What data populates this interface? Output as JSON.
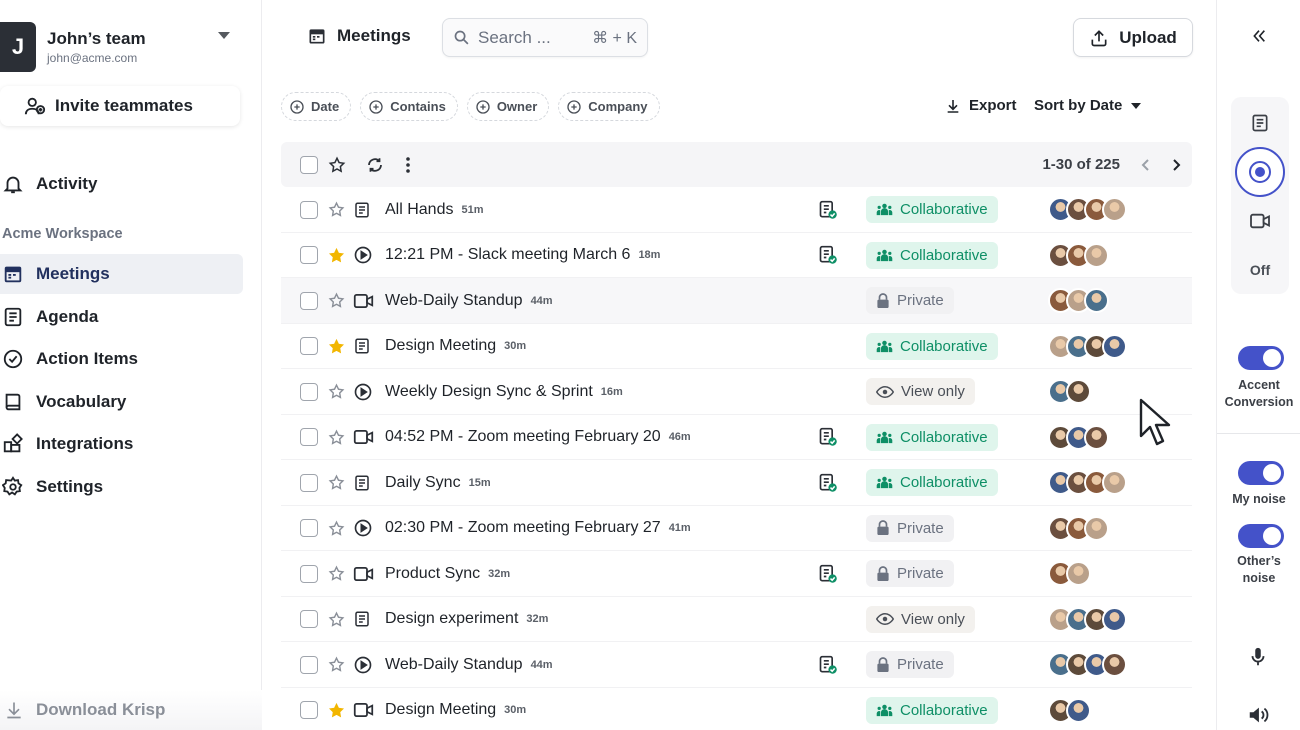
{
  "sidebar": {
    "team": {
      "initial": "J",
      "name": "John’s team",
      "email": "john@acme.com"
    },
    "invite_label": "Invite teammates",
    "activity_label": "Activity",
    "workspace_label": "Acme Workspace",
    "nav": [
      {
        "label": "Meetings",
        "icon": "calendar-icon",
        "active": true
      },
      {
        "label": "Agenda",
        "icon": "document-icon"
      },
      {
        "label": "Action Items",
        "icon": "check-circle-icon"
      },
      {
        "label": "Vocabulary",
        "icon": "book-icon"
      },
      {
        "label": "Integrations",
        "icon": "puzzle-icon"
      },
      {
        "label": "Settings",
        "icon": "gear-icon"
      }
    ],
    "download_label": "Download Krisp"
  },
  "header": {
    "title": "Meetings",
    "search_placeholder": "Search ...",
    "search_shortcut": "⌘ + K",
    "upload_label": "Upload"
  },
  "filters": [
    "Date",
    "Contains",
    "Owner",
    "Company"
  ],
  "toolbar": {
    "export_label": "Export",
    "sort_label": "Sort by Date"
  },
  "pagination": {
    "text": "1-30 of 225"
  },
  "meetings": [
    {
      "title": "All Hands",
      "duration": "51m",
      "starred": false,
      "type": "notes",
      "summary": true,
      "access": "Collaborative",
      "avatars": 4
    },
    {
      "title": "12:21 PM - Slack meeting March 6",
      "duration": "18m",
      "starred": true,
      "type": "play",
      "summary": true,
      "access": "Collaborative",
      "avatars": 3
    },
    {
      "title": "Web-Daily Standup",
      "duration": "44m",
      "starred": false,
      "type": "video",
      "summary": false,
      "access": "Private",
      "avatars": 3,
      "highlight": true
    },
    {
      "title": "Design Meeting",
      "duration": "30m",
      "starred": true,
      "type": "notes",
      "summary": false,
      "access": "Collaborative",
      "avatars": 4
    },
    {
      "title": "Weekly Design Sync & Sprint",
      "duration": "16m",
      "starred": false,
      "type": "play",
      "summary": false,
      "access": "View only",
      "avatars": 2
    },
    {
      "title": "04:52 PM - Zoom meeting February 20",
      "duration": "46m",
      "starred": false,
      "type": "video",
      "summary": true,
      "access": "Collaborative",
      "avatars": 3
    },
    {
      "title": "Daily Sync",
      "duration": "15m",
      "starred": false,
      "type": "notes",
      "summary": true,
      "access": "Collaborative",
      "avatars": 4
    },
    {
      "title": "02:30 PM - Zoom meeting February 27",
      "duration": "41m",
      "starred": false,
      "type": "play",
      "summary": false,
      "access": "Private",
      "avatars": 3
    },
    {
      "title": "Product Sync",
      "duration": "32m",
      "starred": false,
      "type": "video",
      "summary": true,
      "access": "Private",
      "avatars": 2
    },
    {
      "title": "Design experiment",
      "duration": "32m",
      "starred": false,
      "type": "notes",
      "summary": false,
      "access": "View only",
      "avatars": 4
    },
    {
      "title": "Web-Daily Standup",
      "duration": "44m",
      "starred": false,
      "type": "play",
      "summary": true,
      "access": "Private",
      "avatars": 4
    },
    {
      "title": "Design Meeting",
      "duration": "30m",
      "starred": true,
      "type": "video",
      "summary": false,
      "access": "Collaborative",
      "avatars": 2
    }
  ],
  "right_panel": {
    "off_label": "Off",
    "accent_label": "Accent Conversion",
    "my_noise_label": "My noise",
    "others_noise_label": "Other’s noise"
  },
  "colors": {
    "accent": "#4452c9",
    "collab_bg": "#dff5ec",
    "collab_fg": "#0e8f66",
    "star": "#f2b600"
  }
}
